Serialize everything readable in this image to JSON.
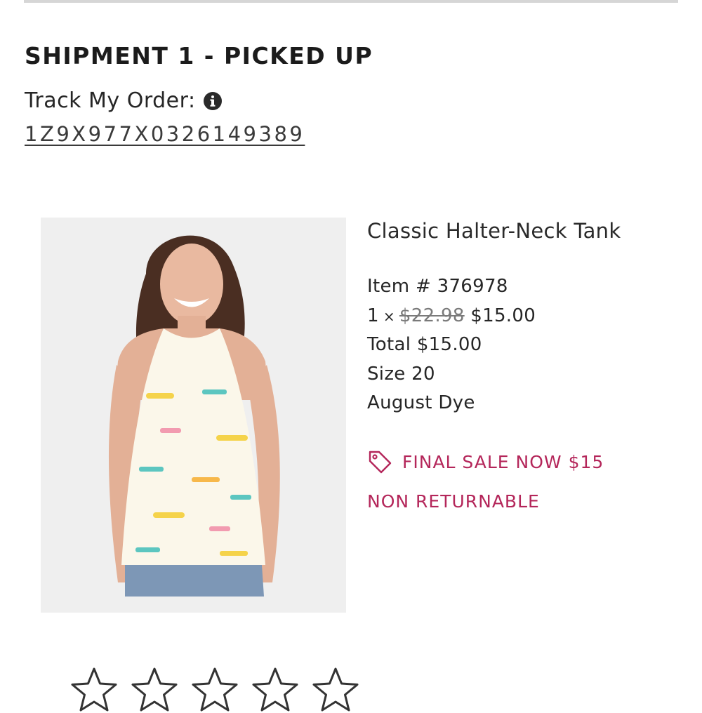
{
  "shipment": {
    "title": "SHIPMENT 1 - PICKED UP",
    "track_label": "Track My Order:",
    "info_icon": "info-circle-icon",
    "tracking_number": "1Z9X977X0326149389"
  },
  "product": {
    "image_icon": "product-photo",
    "name": "Classic Halter-Neck Tank",
    "item_label": "Item #",
    "item_number": "376978",
    "quantity": "1",
    "quantity_symbol": "×",
    "original_price": "$22.98",
    "sale_price": "$15.00",
    "total_label": "Total",
    "total": "$15.00",
    "size_label": "Size",
    "size": "20",
    "color": "August Dye"
  },
  "sale": {
    "tag_icon": "price-tag-icon",
    "final_sale": "FINAL SALE NOW $15",
    "non_returnable": "NON RETURNABLE",
    "accent_color": "#b4265a"
  },
  "rating": {
    "star_icon": "star-outline-icon",
    "max_stars": 5,
    "selected": 0
  }
}
